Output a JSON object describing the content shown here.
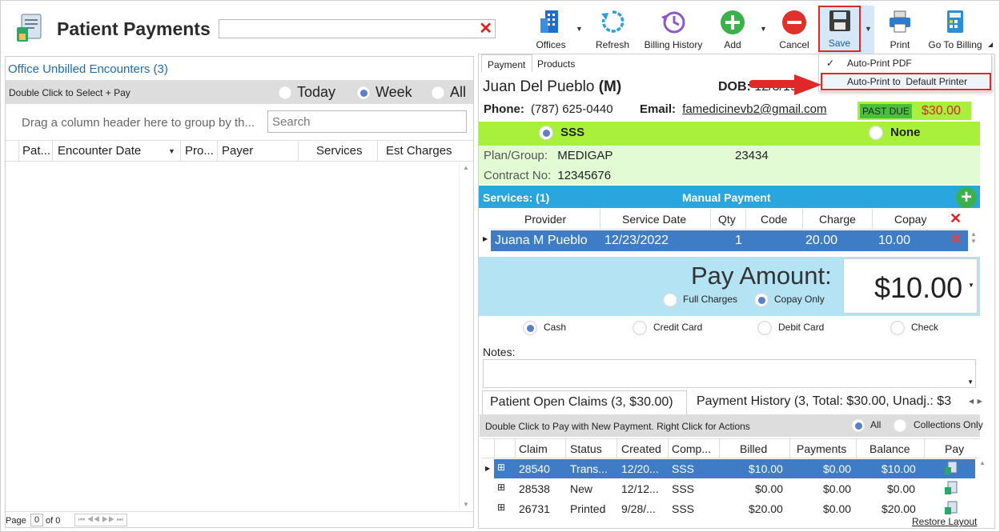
{
  "header": {
    "title": "Patient Payments",
    "search_value": ""
  },
  "toolbar": {
    "offices": "Offices",
    "refresh": "Refresh",
    "billing_history": "Billing History",
    "add": "Add",
    "cancel": "Cancel",
    "save": "Save",
    "print": "Print",
    "go_to_billing": "Go To Billing"
  },
  "save_menu": {
    "items": [
      "Auto-Print PDF",
      "Auto-Print to  Default Printer"
    ],
    "checked": "✓"
  },
  "left": {
    "title": "Office Unbilled Encounters (3)",
    "hint": "Double Click to Select + Pay",
    "filters": [
      "Today",
      "Week",
      "All"
    ],
    "selected_filter": "Week",
    "group_hint": "Drag a column header here to group by th...",
    "search_placeholder": "Search",
    "columns": [
      "Pat...",
      "Encounter Date",
      "Pro...",
      "Payer",
      "Services",
      "Est Charges"
    ],
    "pager": {
      "label": "Page",
      "current": "0",
      "of": "of 0",
      "nav": "⏮ ◀◀ ▶▶ ⏭"
    }
  },
  "right": {
    "tabs": [
      "Payment",
      "Products"
    ],
    "patient_name": "Juan Del Pueblo",
    "sex": "(M)",
    "dob_label": "DOB:",
    "dob_value": "12/3/19",
    "phone_label": "Phone:",
    "phone": "(787) 625-0440",
    "email_label": "Email:",
    "email": "famedicinevb2@gmail.com",
    "past_due_label": "PAST DUE",
    "past_due_amount": "$30.00",
    "insurance": [
      "SSS",
      "None"
    ],
    "plan_label": "Plan/Group:",
    "plan_value": "MEDIGAP",
    "group_value": "23434",
    "contract_label": "Contract No:",
    "contract_value": "12345676",
    "services_label": "Services: (1)",
    "manual_payment": "Manual Payment",
    "service_columns": [
      "Provider",
      "Service Date",
      "Qty",
      "Code",
      "Charge",
      "Copay"
    ],
    "service_rows": [
      {
        "provider": "Juana M Pueblo",
        "date": "12/23/2022",
        "qty": "1",
        "code": "",
        "charge": "20.00",
        "copay": "10.00"
      }
    ],
    "pay_amount_label": "Pay Amount:",
    "pay_amount": "$10.00",
    "pay_basis": [
      "Full Charges",
      "Copay Only"
    ],
    "pay_methods": [
      "Cash",
      "Credit Card",
      "Debit Card",
      "Check"
    ],
    "notes_label": "Notes:",
    "bottom_tabs": [
      "Patient Open Claims (3, $30.00)",
      "Payment History (3, Total: $30.00, Unadj.: $3"
    ],
    "claims_hint": "Double Click to Pay with New Payment. Right Click for Actions",
    "claims_filter": [
      "All",
      "Collections Only"
    ],
    "claim_columns": [
      "Claim",
      "Status",
      "Created",
      "Comp...",
      "Billed",
      "Payments",
      "Balance",
      "Pay"
    ],
    "claims": [
      {
        "claim": "28540",
        "status": "Trans...",
        "created": "12/20...",
        "comp": "SSS",
        "billed": "$10.00",
        "payments": "$0.00",
        "balance": "$10.00"
      },
      {
        "claim": "28538",
        "status": "New",
        "created": "12/12...",
        "comp": "SSS",
        "billed": "$0.00",
        "payments": "$0.00",
        "balance": "$0.00"
      },
      {
        "claim": "26731",
        "status": "Printed",
        "created": "9/28/...",
        "comp": "SSS",
        "billed": "$20.00",
        "payments": "$0.00",
        "balance": "$20.00"
      }
    ],
    "restore_layout": "Restore Layout"
  }
}
